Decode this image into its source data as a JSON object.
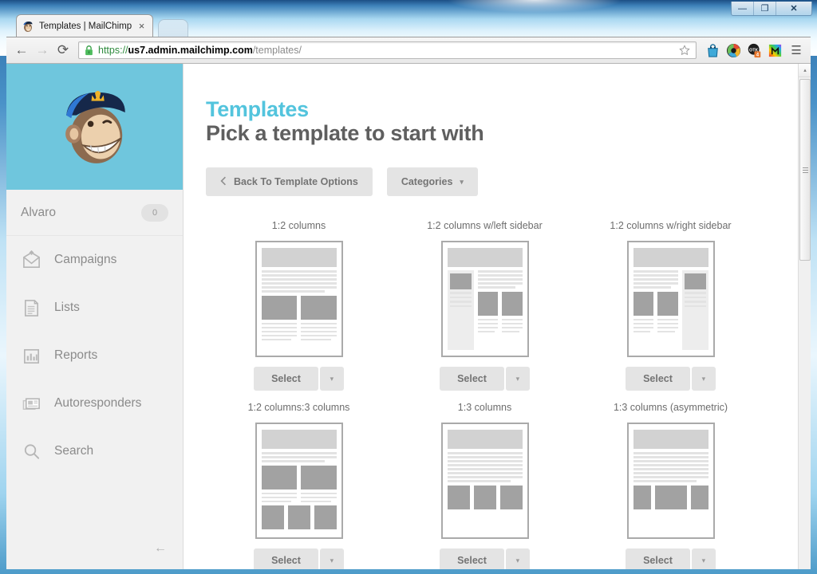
{
  "window": {
    "minimize_label": "—",
    "maximize_label": "❐",
    "close_label": "✕"
  },
  "browser": {
    "tab": {
      "title": "Templates | MailChimp",
      "favicon": "mailchimp-freddie-icon",
      "close_label": "×"
    },
    "nav": {
      "back_label": "←",
      "forward_label": "→",
      "reload_label": "⟳"
    },
    "omnibox": {
      "scheme": "https://",
      "host": "us7.admin.mailchimp.com",
      "path": "/templates/",
      "lock_icon": "padlock-secure-icon",
      "star_label": "☆"
    },
    "extensions": [
      {
        "name": "bag-extension-icon"
      },
      {
        "name": "color-wheel-extension-icon"
      },
      {
        "name": "otk-badge-extension-icon",
        "badge": "4"
      },
      {
        "name": "rainbow-square-extension-icon"
      }
    ],
    "menu_label": "☰"
  },
  "sidebar": {
    "brand_icon": "mailchimp-freddie-logo",
    "account": {
      "name": "Alvaro",
      "badge": "0"
    },
    "items": [
      {
        "label": "Campaigns",
        "icon": "envelope-icon"
      },
      {
        "label": "Lists",
        "icon": "document-icon"
      },
      {
        "label": "Reports",
        "icon": "bar-chart-icon"
      },
      {
        "label": "Autoresponders",
        "icon": "stacked-cards-icon"
      },
      {
        "label": "Search",
        "icon": "magnifier-icon"
      }
    ],
    "collapse_label": "←"
  },
  "main": {
    "kicker": "Templates",
    "title": "Pick a template to start with",
    "actions": {
      "back": {
        "label": "Back To Template Options",
        "icon": "chevron-left-icon"
      },
      "categories": {
        "label": "Categories",
        "caret": "▾"
      }
    },
    "select_label": "Select",
    "select_caret": "▾",
    "templates": [
      {
        "label": "1:2 columns",
        "layout": "two-col"
      },
      {
        "label": "1:2 columns w/left sidebar",
        "layout": "left-sidebar"
      },
      {
        "label": "1:2 columns w/right sidebar",
        "layout": "right-sidebar"
      },
      {
        "label": "1:2 columns:3 columns",
        "layout": "two-then-three"
      },
      {
        "label": "1:3 columns",
        "layout": "three-col"
      },
      {
        "label": "1:3 columns (asymmetric)",
        "layout": "three-col-asym"
      }
    ]
  },
  "scrollbar": {
    "up_label": "▴"
  },
  "colors": {
    "brand_cyan": "#6fc6dd",
    "kicker_blue": "#53c4dd",
    "title_gray": "#5f5f5f",
    "sidebar_bg": "#f1f1f1",
    "button_gray": "#e4e4e4"
  }
}
